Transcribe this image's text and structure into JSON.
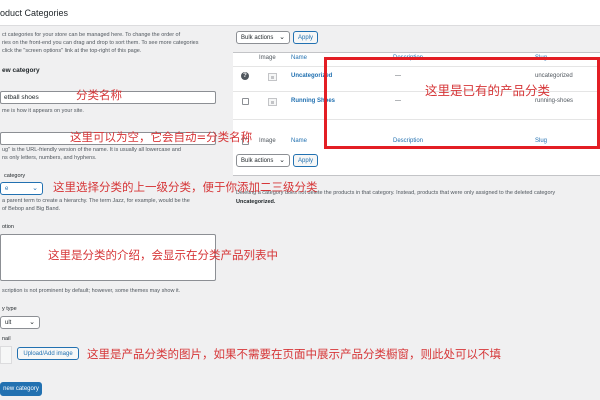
{
  "page": {
    "title": "oduct Categories"
  },
  "form": {
    "intro_lines": [
      "ct categories for your store can be managed here. To change the order of",
      "ries on the front-end you can drag and drop to sort them. To see more categories",
      "click the \"screen options\" link at the top-right of this page."
    ],
    "heading": "ew category",
    "name": {
      "value": "etball shoes",
      "hint": "me is how it appears on your site."
    },
    "slug": {
      "hint_lines": [
        "ug\" is the URL-friendly version of the name. It is usually all lowercase and",
        "ns only letters, numbers, and hyphens."
      ]
    },
    "parent": {
      "label": "category",
      "selected": "e",
      "hint_lines": [
        "a parent term to create a hierarchy. The term Jazz, for example, would be the",
        "of Bebop and Big Band."
      ]
    },
    "description": {
      "label": "otion",
      "hint": "scription is not prominent by default; however, some themes may show it."
    },
    "display_type": {
      "label": "y type",
      "selected": "ult"
    },
    "thumbnail": {
      "label": "nail",
      "upload_label": "Upload/Add image"
    },
    "submit_label": "new category"
  },
  "annotations": {
    "name": "分类名称",
    "slug": "这里可以为空，它会自动=分类名称",
    "parent": "这里选择分类的上一级分类，便于你添加二三级分类",
    "description": "这里是分类的介绍，会显示在分类产品列表中",
    "thumbnail": "这里是产品分类的图片，如果不需要在页面中展示产品分类橱窗，则此处可以不填",
    "existing": "这里是已有的产品分类"
  },
  "table": {
    "bulk_label": "Bulk actions",
    "apply_label": "Apply",
    "columns": {
      "image": "Image",
      "name": "Name",
      "description": "Description",
      "slug": "Slug"
    },
    "rows": [
      {
        "name": "Uncategorized",
        "description": "—",
        "slug": "uncategorized"
      },
      {
        "name": "Running Shoes",
        "description": "—",
        "slug": "running-shoes"
      }
    ],
    "note_lines": [
      "Deleting a category does not delete the products in that category. Instead, products that were only assigned to the deleted category",
      "Uncategorized."
    ]
  }
}
